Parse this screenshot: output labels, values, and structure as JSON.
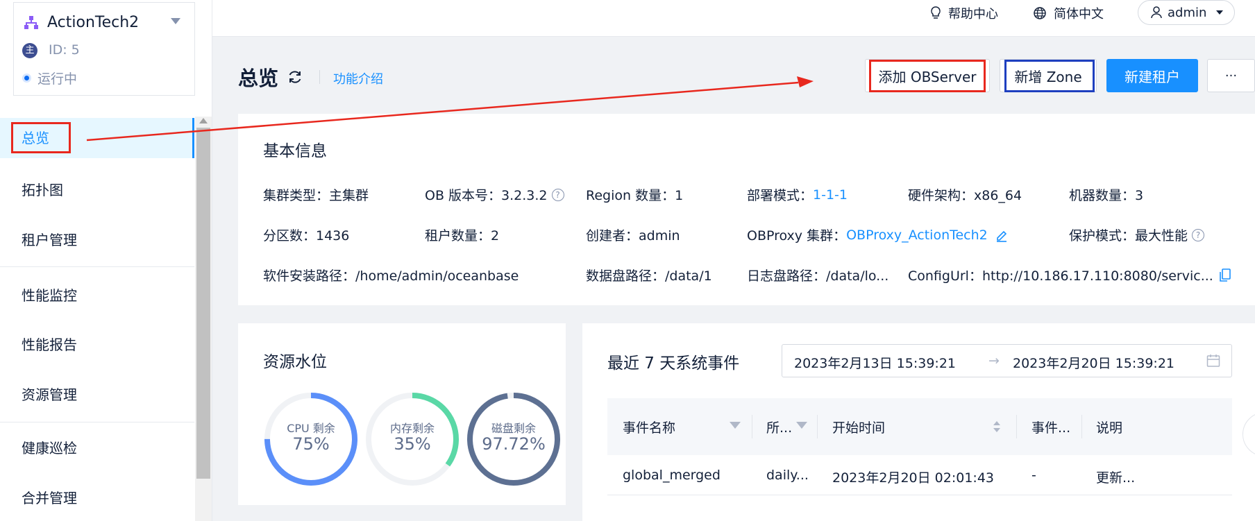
{
  "cluster": {
    "name": "ActionTech2",
    "role_badge": "主",
    "id_text": "ID: 5",
    "status": "运行中"
  },
  "nav": {
    "items": [
      {
        "label": "总览"
      },
      {
        "label": "拓扑图"
      },
      {
        "label": "租户管理"
      },
      {
        "label": "性能监控"
      },
      {
        "label": "性能报告"
      },
      {
        "label": "资源管理"
      },
      {
        "label": "健康巡检"
      },
      {
        "label": "合并管理"
      }
    ]
  },
  "topbar": {
    "help": "帮助中心",
    "language": "简体中文",
    "user": "admin"
  },
  "header": {
    "title": "总览",
    "feature_link": "功能介绍",
    "add_observer": "添加 OBServer",
    "add_zone": "新增 Zone",
    "new_tenant": "新建租户",
    "more": "···"
  },
  "basic_info": {
    "title": "基本信息",
    "cluster_type": "集群类型：主集群",
    "ob_version": "OB 版本号：3.2.3.2",
    "region_count": "Region 数量：1",
    "deploy_mode_label": "部署模式：",
    "deploy_mode_value": "1-1-1",
    "hardware_arch": "硬件架构：x86_64",
    "machine_count": "机器数量：3",
    "partition_count": "分区数：1436",
    "tenant_count": "租户数量：2",
    "creator": "创建者：admin",
    "obproxy_label": "OBProxy 集群：",
    "obproxy_value": "OBProxy_ActionTech2",
    "protect_mode": "保护模式：最大性能",
    "install_path": "软件安装路径：/home/admin/oceanbase",
    "data_disk_path": "数据盘路径：/data/1",
    "log_disk_path": "日志盘路径：/data/lo...",
    "config_url": "ConfigUrl：http://10.186.17.110:8080/servic..."
  },
  "resource": {
    "title": "资源水位",
    "gauges": [
      {
        "label": "CPU 剩余",
        "value": "75%",
        "fraction": 0.75,
        "color": "#5b8ff9"
      },
      {
        "label": "内存剩余",
        "value": "35%",
        "fraction": 0.35,
        "color": "#5ad8a6"
      },
      {
        "label": "磁盘剩余",
        "value": "97.72%",
        "fraction": 0.9772,
        "color": "#5d7092"
      }
    ]
  },
  "events": {
    "title": "最近 7 天系统事件",
    "range_start": "2023年2月13日 15:39:21",
    "range_arrow": "→",
    "range_end": "2023年2月20日 15:39:21",
    "columns": [
      "事件名称",
      "所...",
      "开始时间",
      "事件...",
      "说明"
    ],
    "rows": [
      [
        "global_merged",
        "daily...",
        "2023年2月20日 02:01:43",
        "-",
        "更新..."
      ]
    ]
  }
}
